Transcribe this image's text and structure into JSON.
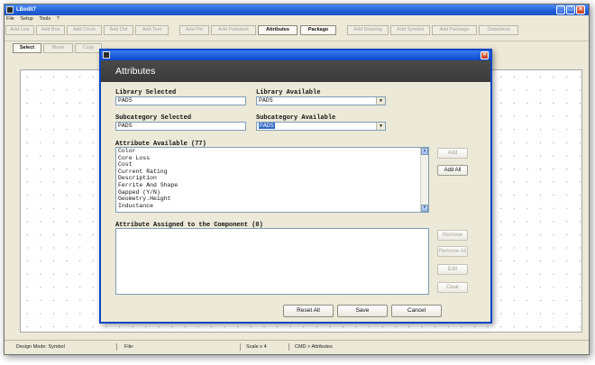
{
  "window": {
    "title": "LBedit7"
  },
  "menu": [
    "File",
    "Setup",
    "Tools",
    "?"
  ],
  "toolbar": {
    "buttons": [
      {
        "label": "Add Line"
      },
      {
        "label": "Add Box"
      },
      {
        "label": "Add Circle"
      },
      {
        "label": "Add Dot"
      },
      {
        "label": "Add Text"
      },
      {
        "label": "Add Pin"
      },
      {
        "label": "Add Padstack"
      },
      {
        "label": "Attributes"
      },
      {
        "label": "Package"
      },
      {
        "label": "Add Drawing"
      },
      {
        "label": "Add Symbol"
      },
      {
        "label": "Add Package"
      },
      {
        "label": "Datasheet"
      }
    ],
    "secondary": [
      {
        "label": "Select"
      },
      {
        "label": "Move"
      },
      {
        "label": "Copy"
      }
    ]
  },
  "dialog": {
    "title": "Attributes",
    "library_selected": {
      "label": "Library Selected",
      "value": "PADS"
    },
    "library_available": {
      "label": "Library Available",
      "value": "PADS"
    },
    "subcategory_selected": {
      "label": "Subcategory Selected",
      "value": "PADS"
    },
    "subcategory_available": {
      "label": "Subcategory Available",
      "value": "PADS"
    },
    "attr_available": {
      "label": "Attribute Available (77)",
      "items": [
        "Color",
        "Core Loss",
        "Cost",
        "Current Rating",
        "Description",
        "Ferrite And Shape",
        "Gapped (Y/N)",
        "Geometry.Height",
        "Inductance"
      ]
    },
    "attr_assigned": {
      "label": "Attribute Assigned to the Component (0)"
    },
    "side_buttons": {
      "add": "Add",
      "add_all": "Add All",
      "remove": "Remove",
      "remove_all": "Remove All",
      "edit": "Edit",
      "clear": "Clear"
    },
    "bottom_buttons": {
      "reset_all": "Reset All",
      "save": "Save",
      "cancel": "Cancel"
    }
  },
  "status": {
    "design_mode": "Design Mode: Symbol",
    "file": "File:",
    "scale": "Scale x 4",
    "cmd": "CMD > Attributes"
  }
}
